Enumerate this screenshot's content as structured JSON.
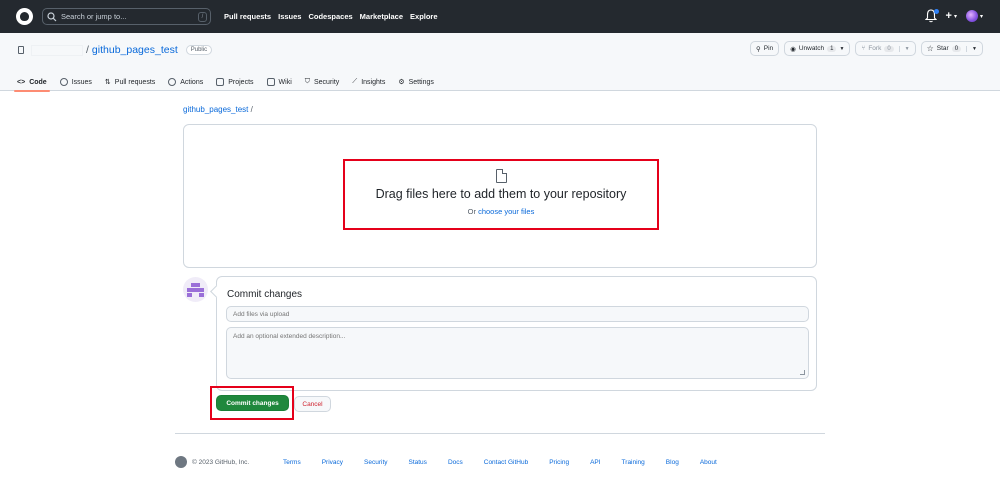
{
  "header": {
    "search_placeholder": "Search or jump to...",
    "search_shortcut": "/",
    "nav": [
      "Pull requests",
      "Issues",
      "Codespaces",
      "Marketplace",
      "Explore"
    ],
    "plus_label": "+"
  },
  "repo": {
    "name": "github_pages_test",
    "separator": "/",
    "visibility": "Public",
    "actions": {
      "pin": "Pin",
      "unwatch": "Unwatch",
      "unwatch_count": "1",
      "fork": "Fork",
      "fork_count": "0",
      "star": "Star",
      "star_count": "0"
    },
    "tabs": [
      "Code",
      "Issues",
      "Pull requests",
      "Actions",
      "Projects",
      "Wiki",
      "Security",
      "Insights",
      "Settings"
    ]
  },
  "breadcrumb": {
    "repo": "github_pages_test",
    "sep": "/"
  },
  "dropzone": {
    "title": "Drag files here to add them to your repository",
    "sub_prefix": "Or ",
    "sub_link": "choose your files"
  },
  "commit": {
    "title": "Commit changes",
    "summary_placeholder": "Add files via upload",
    "description_placeholder": "Add an optional extended description...",
    "commit_button": "Commit changes",
    "cancel_button": "Cancel"
  },
  "footer": {
    "copyright": "© 2023 GitHub, Inc.",
    "links": [
      "Terms",
      "Privacy",
      "Security",
      "Status",
      "Docs",
      "Contact GitHub",
      "Pricing",
      "API",
      "Training",
      "Blog",
      "About"
    ]
  },
  "colors": {
    "header_bg": "#24292f",
    "link": "#0969da",
    "primary_button": "#1f883d",
    "danger": "#cf222e",
    "highlight_box": "#e5001a"
  }
}
